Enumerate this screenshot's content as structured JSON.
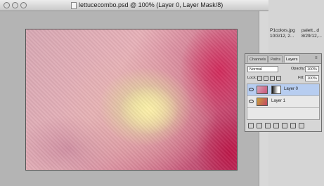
{
  "window": {
    "title": "lettucecombo.psd @ 100% (Layer 0, Layer Mask/8)"
  },
  "desktop": {
    "files": [
      {
        "name": "P1colors.jpg",
        "date": "10/3/12, 2..."
      },
      {
        "name": "palett...d",
        "date": "8/29/12,..."
      }
    ]
  },
  "layers_panel": {
    "tabs": [
      {
        "label": "Channels"
      },
      {
        "label": "Paths"
      },
      {
        "label": "Layers"
      }
    ],
    "blend_mode": "Normal",
    "opacity_label": "Opacity:",
    "opacity_value": "100%",
    "lock_label": "Lock:",
    "fill_label": "Fill:",
    "fill_value": "100%",
    "layers": [
      {
        "name": "Layer 0",
        "selected": true,
        "has_mask": true
      },
      {
        "name": "Layer 1",
        "selected": false,
        "has_mask": false
      }
    ]
  },
  "colors": {
    "selection": "#b7cdf0",
    "canvas_bg": "#b4b4b4"
  }
}
